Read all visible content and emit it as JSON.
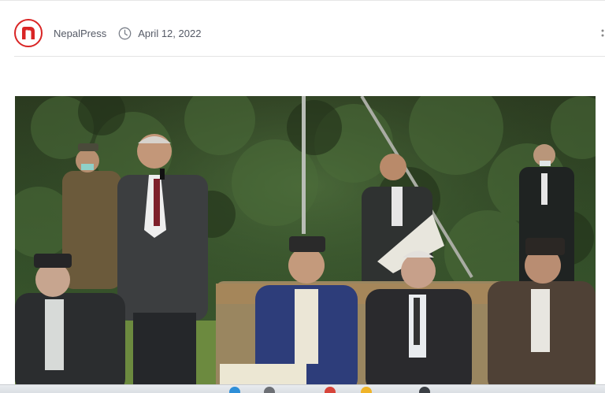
{
  "meta": {
    "author": "NepalPress",
    "date": "April 12, 2022",
    "logo_letter": "n",
    "icons": [
      "nepalpress-logo",
      "clock-icon",
      "share-icon"
    ]
  },
  "colors": {
    "brand_red": "#d92525",
    "meta_text": "#555a66"
  }
}
